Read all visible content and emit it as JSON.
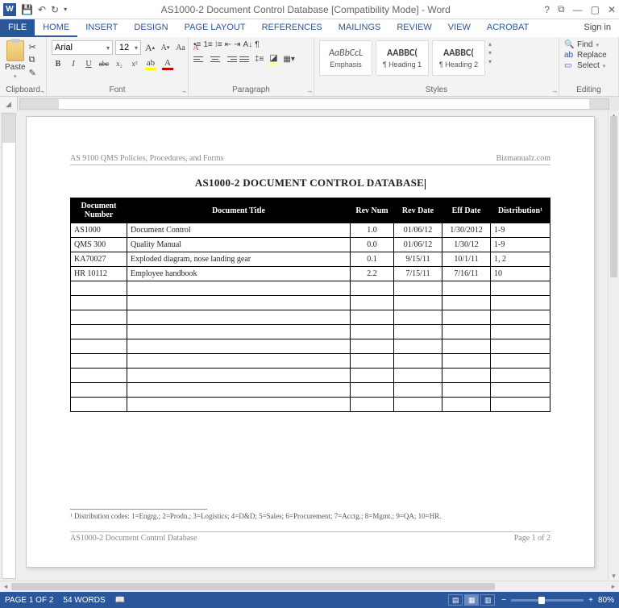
{
  "titlebar": {
    "title": "AS1000-2 Document Control Database [Compatibility Mode] - Word",
    "signin": "Sign in"
  },
  "tabs": {
    "file": "FILE",
    "home": "HOME",
    "insert": "INSERT",
    "design": "DESIGN",
    "pagelayout": "PAGE LAYOUT",
    "references": "REFERENCES",
    "mailings": "MAILINGS",
    "review": "REVIEW",
    "view": "VIEW",
    "acrobat": "ACROBAT"
  },
  "ribbon": {
    "clipboard": {
      "label": "Clipboard",
      "paste": "Paste"
    },
    "font": {
      "label": "Font",
      "name": "Arial",
      "size": "12",
      "bold": "B",
      "italic": "I",
      "underline": "U",
      "strike": "abc",
      "sub": "x₂",
      "sup": "x²",
      "grow": "A",
      "shrink": "A",
      "case": "Aa",
      "clear": "A"
    },
    "paragraph": {
      "label": "Paragraph"
    },
    "styles": {
      "label": "Styles",
      "items": [
        {
          "preview": "AaBbCcL",
          "name": "Emphasis",
          "previewStyle": "font-style:italic;font-size:12px;color:#555"
        },
        {
          "preview": "AABBC(",
          "name": "¶ Heading 1",
          "previewStyle": "font-weight:bold;font-size:12px"
        },
        {
          "preview": "AABBC(",
          "name": "¶ Heading 2",
          "previewStyle": "font-weight:bold;font-size:12px"
        }
      ]
    },
    "editing": {
      "label": "Editing",
      "find": "Find",
      "replace": "Replace",
      "select": "Select"
    }
  },
  "document": {
    "header_left": "AS 9100 QMS Policies, Procedures, and Forms",
    "header_right": "Bizmanualz.com",
    "title": "AS1000-2 DOCUMENT CONTROL DATABASE",
    "columns": [
      "Document Number",
      "Document Title",
      "Rev Num",
      "Rev Date",
      "Eff Date",
      "Distribution¹"
    ],
    "rows": [
      {
        "num": "AS1000",
        "title": "Document Control",
        "rev": "1.0",
        "revdate": "01/06/12",
        "effdate": "1/30/2012",
        "dist": "1-9"
      },
      {
        "num": "QMS 300",
        "title": "Quality Manual",
        "rev": "0.0",
        "revdate": "01/06/12",
        "effdate": "1/30/12",
        "dist": "1-9"
      },
      {
        "num": "KA70027",
        "title": "Exploded diagram, nose landing gear",
        "rev": "0.1",
        "revdate": "9/15/11",
        "effdate": "10/1/11",
        "dist": "1, 2"
      },
      {
        "num": "HR 10112",
        "title": "Employee handbook",
        "rev": "2.2",
        "revdate": "7/15/11",
        "effdate": "7/16/11",
        "dist": "10"
      }
    ],
    "empty_rows": 9,
    "footnote": "¹ Distribution codes: 1=Engrg.; 2=Prodn.; 3=Logistics; 4=D&D; 5=Sales; 6=Procurement; 7=Acctg.; 8=Mgmt.; 9=QA; 10=HR.",
    "footer_left": "AS1000-2 Document Control Database",
    "footer_right": "Page 1 of 2"
  },
  "statusbar": {
    "page": "PAGE 1 OF 2",
    "words": "54 WORDS",
    "zoom": "80%"
  }
}
